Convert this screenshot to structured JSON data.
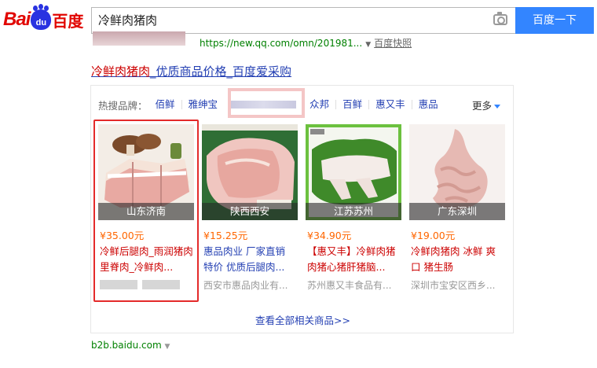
{
  "header": {
    "logo": {
      "text_bai": "Bai",
      "text_du": "du",
      "text_cn": "百度"
    },
    "search": {
      "query": "冷鲜肉猪肉",
      "camera_icon": "camera-icon"
    },
    "search_button": "百度一下"
  },
  "prev_result": {
    "url": "https://new.qq.com/omn/201981...",
    "snapshot": "百度快照"
  },
  "result": {
    "title_em": "冷鲜肉猪肉",
    "title_rest": "_优质商品价格_百度爱采购"
  },
  "brands": {
    "label": "热搜品牌：",
    "items": [
      "佰鲜",
      "雅绅宝",
      "众邦",
      "百鲜",
      "惠又丰",
      "惠品"
    ],
    "more": "更多"
  },
  "products": [
    {
      "location": "山东济南",
      "price": "¥35.00元",
      "title": "冷鲜后腿肉_雨润猪肉里脊肉_冷鲜肉...",
      "seller": ""
    },
    {
      "location": "陕西西安",
      "price": "¥15.25元",
      "title": "惠品肉业 厂家直销 特价 优质后腿肉...",
      "seller": "西安市惠品肉业有..."
    },
    {
      "location": "江苏苏州",
      "price": "¥34.90元",
      "title": "【惠又丰】冷鲜肉猪肉猪心猪肝猪脑...",
      "seller": "苏州惠又丰食品有..."
    },
    {
      "location": "广东深圳",
      "price": "¥19.00元",
      "title": "冷鲜肉猪肉 冰鲜 爽口 猪生肠",
      "seller": "深圳市宝安区西乡..."
    }
  ],
  "view_all": "查看全部相关商品>>",
  "source_url": "b2b.baidu.com",
  "colors": {
    "accent": "#3385ff",
    "link": "#2440b3",
    "em": "#cc0000",
    "price": "#ff6600",
    "url_green": "#008000"
  }
}
